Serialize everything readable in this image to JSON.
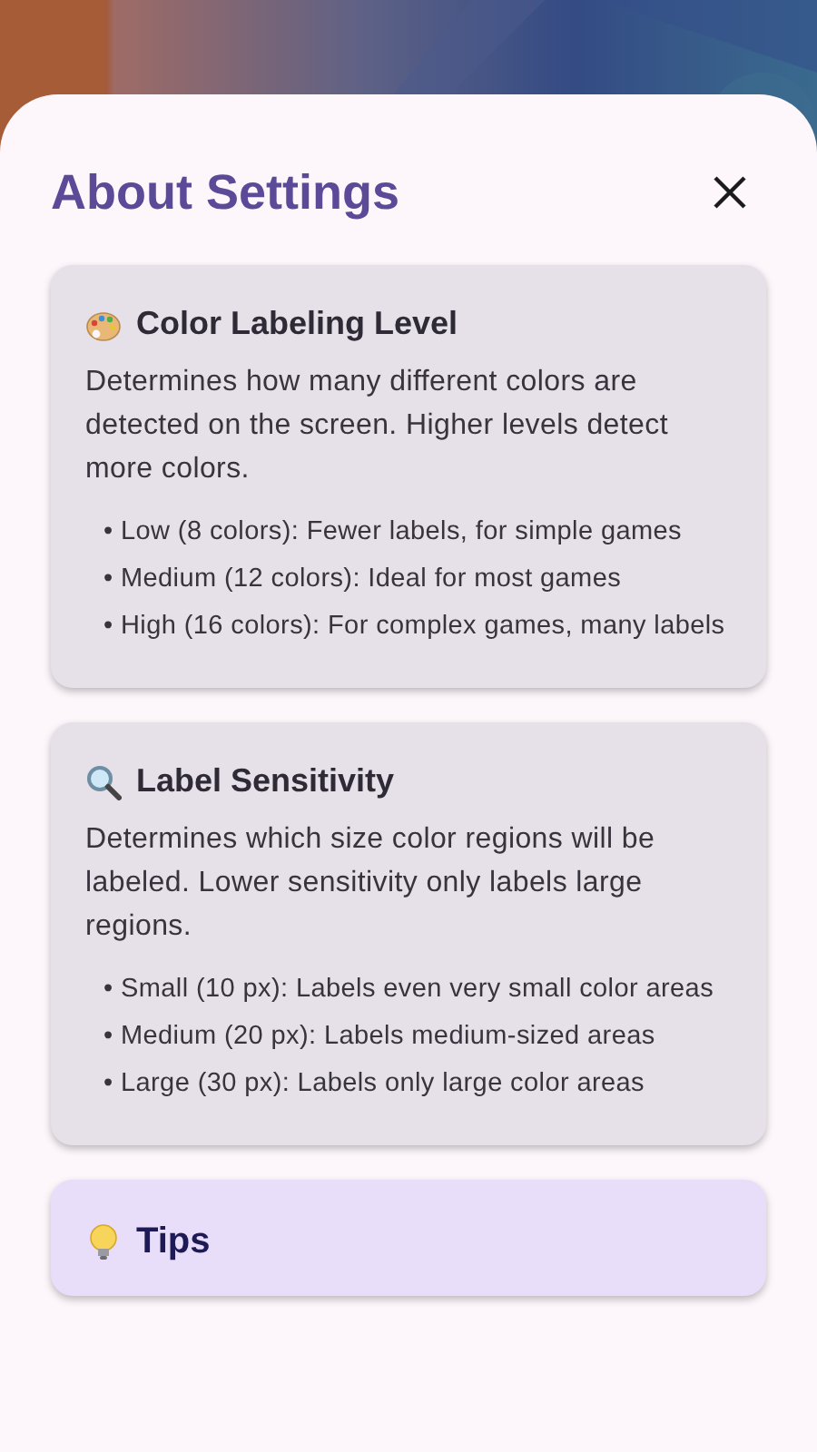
{
  "sheet": {
    "title": "About Settings"
  },
  "sections": [
    {
      "kind": "palette",
      "title": "Color Labeling Level",
      "description": "Determines how many different colors are detected on the screen. Higher levels detect more colors.",
      "bullets": [
        "• Low (8 colors): Fewer labels, for simple games",
        "• Medium (12 colors): Ideal for most games",
        "• High (16 colors): For complex games, many labels"
      ]
    },
    {
      "kind": "magnifier",
      "title": "Label Sensitivity",
      "description": "Determines which size color regions will be labeled. Lower sensitivity only labels large regions.",
      "bullets": [
        "• Small (10 px): Labels even very small color areas",
        "• Medium (20 px): Labels medium-sized areas",
        "• Large (30 px): Labels only large color areas"
      ]
    },
    {
      "kind": "bulb",
      "title": "Tips"
    }
  ]
}
